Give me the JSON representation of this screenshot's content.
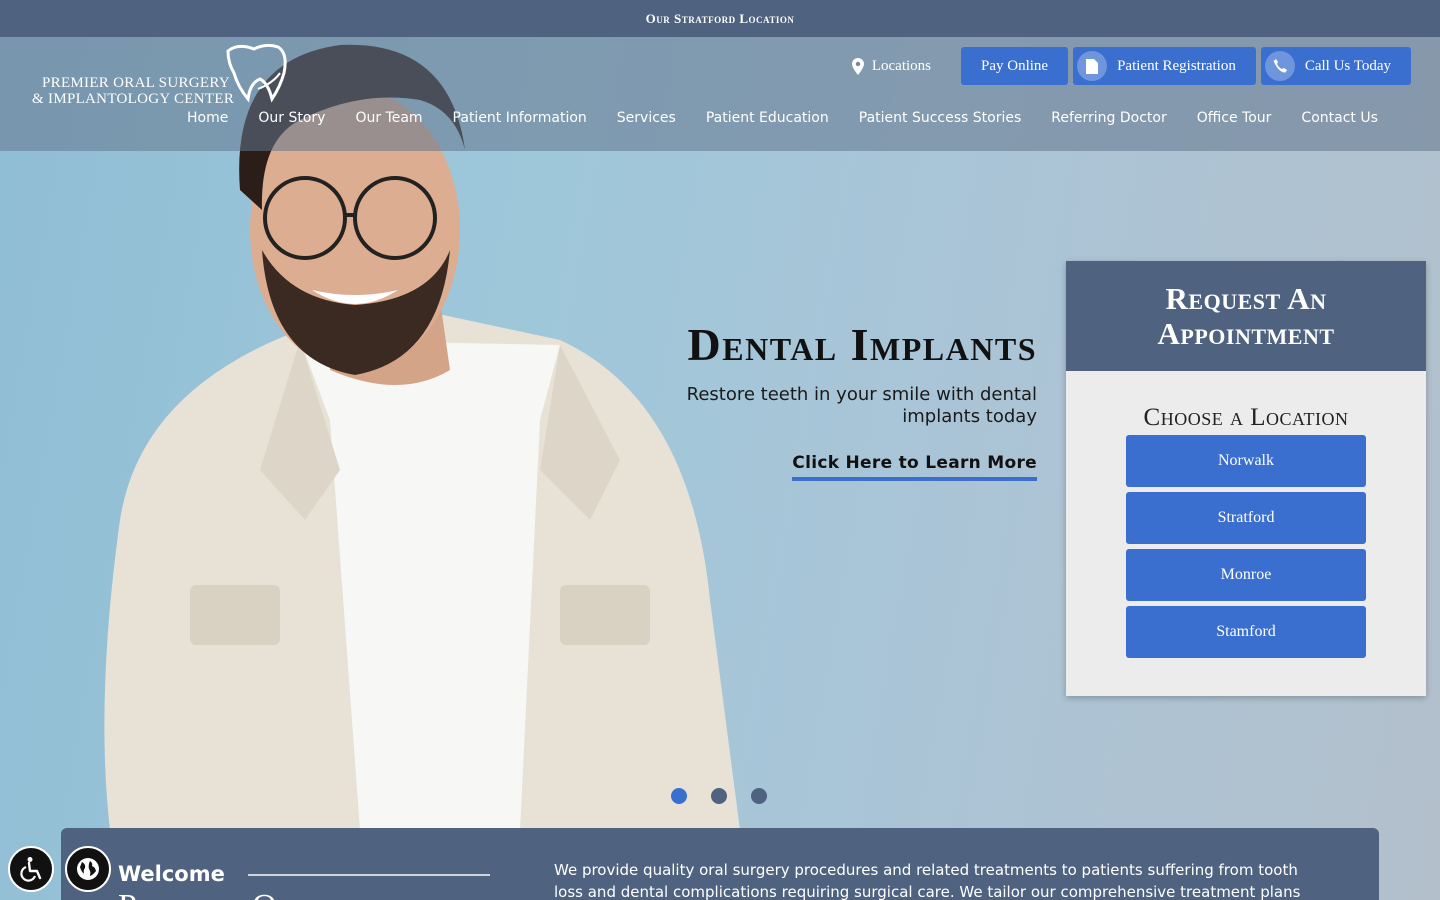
{
  "topbar": {
    "text": "Our Stratford Location"
  },
  "logo": {
    "line1": "PREMIER ORAL SURGERY",
    "line2": "& IMPLANTOLOGY CENTER"
  },
  "utility": {
    "locations": "Locations",
    "pay_online": "Pay Online",
    "patient_registration": "Patient Registration",
    "call_us": "Call Us Today"
  },
  "nav": {
    "items": [
      {
        "label": "Home"
      },
      {
        "label": "Our Story"
      },
      {
        "label": "Our Team"
      },
      {
        "label": "Patient Information"
      },
      {
        "label": "Services"
      },
      {
        "label": "Patient Education"
      },
      {
        "label": "Patient Success Stories"
      },
      {
        "label": "Referring Doctor"
      },
      {
        "label": "Office Tour"
      },
      {
        "label": "Contact Us"
      }
    ]
  },
  "slide": {
    "title": "Dental Implants",
    "subtitle": "Restore teeth in your smile with dental implants today",
    "cta": "Click Here to Learn More",
    "active_index": 0,
    "count": 3
  },
  "appointment": {
    "heading_line1": "Request An",
    "heading_line2": "Appointment",
    "choose": "Choose a Location",
    "locations": [
      {
        "label": "Norwalk"
      },
      {
        "label": "Stratford"
      },
      {
        "label": "Monroe"
      },
      {
        "label": "Stamford"
      }
    ]
  },
  "welcome": {
    "label": "Welcome",
    "title": "Premier Oral",
    "text": "We provide quality oral surgery procedures and related treatments to patients suffering from tooth loss and dental complications requiring surgical care. We tailor our comprehensive treatment plans"
  },
  "colors": {
    "accent": "#3a6fd0",
    "navy": "#4f6280"
  }
}
